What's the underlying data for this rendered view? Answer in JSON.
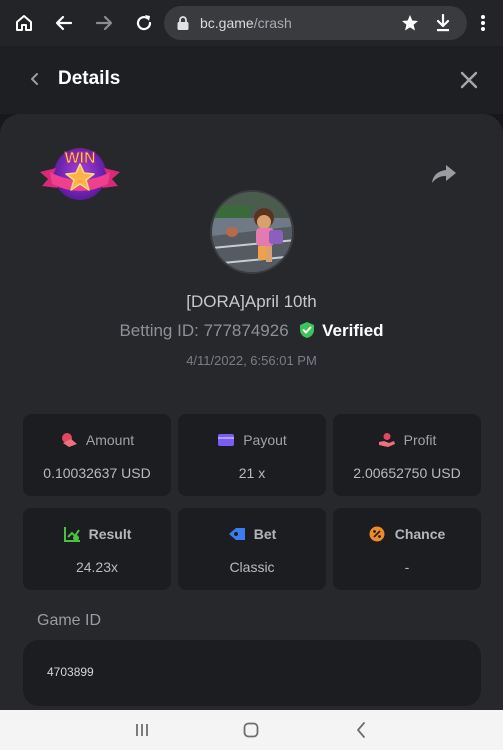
{
  "browser": {
    "url_domain": "bc.game",
    "url_path": "/crash"
  },
  "details": {
    "title": "Details"
  },
  "bet": {
    "player_name": "[DORA]April 10th",
    "betting_id_label": "Betting ID:",
    "betting_id": "777874926",
    "verified_label": "Verified",
    "timestamp": "4/11/2022, 6:56:01 PM",
    "badge": "WIN"
  },
  "stats": {
    "amount": {
      "label": "Amount",
      "value": "0.10032637 USD",
      "icon": "coins-icon",
      "color": "#e2485f"
    },
    "payout": {
      "label": "Payout",
      "value": "21 x",
      "icon": "wallet-icon",
      "color": "#7b5cf5"
    },
    "profit": {
      "label": "Profit",
      "value": "2.00652750 USD",
      "icon": "hand-coin-icon",
      "color": "#e2485f"
    },
    "result": {
      "label": "Result",
      "value": "24.23x",
      "icon": "chart-check-icon",
      "color": "#4cc13f"
    },
    "bet": {
      "label": "Bet",
      "value": "Classic",
      "icon": "ticket-icon",
      "color": "#3d7cf0"
    },
    "chance": {
      "label": "Chance",
      "value": "-",
      "icon": "percent-icon",
      "color": "#ef8a2b"
    }
  },
  "game": {
    "id_label": "Game ID",
    "id_value": "4703899"
  }
}
